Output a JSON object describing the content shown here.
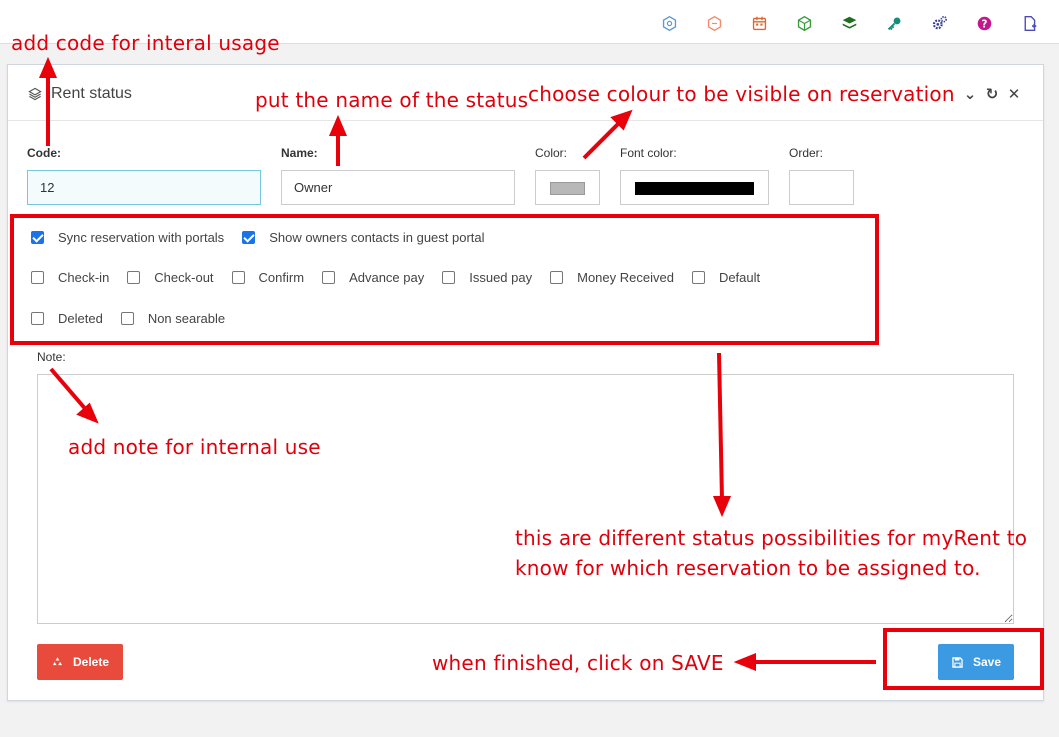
{
  "toolbar": {
    "icons": [
      {
        "name": "portal-icon",
        "color": "#5b9bd5"
      },
      {
        "name": "hexagon-icon",
        "color": "#f28b6b"
      },
      {
        "name": "calendar-icon",
        "color": "#e2662a"
      },
      {
        "name": "cube-icon",
        "color": "#3a9a3a"
      },
      {
        "name": "layers-icon",
        "color": "#1f6e1f"
      },
      {
        "name": "key-icon",
        "color": "#148d7b"
      },
      {
        "name": "cogs-icon",
        "color": "#3a3f8f"
      },
      {
        "name": "help-icon",
        "color": "#c2188b"
      },
      {
        "name": "new-document-icon",
        "color": "#4a4ab8"
      }
    ]
  },
  "panel": {
    "title": "Rent status",
    "tools": {
      "collapse": "⌄",
      "refresh": "↻",
      "close": "✕"
    }
  },
  "form": {
    "code_label": "Code:",
    "code_value": "12",
    "name_label": "Name:",
    "name_value": "Owner",
    "color_label": "Color:",
    "color_value": "#b8b8b8",
    "font_color_label": "Font color:",
    "font_color_value": "#000000",
    "order_label": "Order:",
    "order_value": "",
    "note_label": "Note:",
    "note_value": ""
  },
  "options": {
    "row1": [
      {
        "label": "Sync reservation with portals",
        "checked": true
      },
      {
        "label": "Show owners contacts in guest portal",
        "checked": true
      }
    ],
    "row2": [
      {
        "label": "Check-in",
        "checked": false
      },
      {
        "label": "Check-out",
        "checked": false
      },
      {
        "label": "Confirm",
        "checked": false
      },
      {
        "label": "Advance pay",
        "checked": false
      },
      {
        "label": "Issued pay",
        "checked": false
      },
      {
        "label": "Money Received",
        "checked": false
      },
      {
        "label": "Default",
        "checked": false
      }
    ],
    "row3": [
      {
        "label": "Deleted",
        "checked": false
      },
      {
        "label": "Non searable",
        "checked": false
      }
    ]
  },
  "buttons": {
    "delete_label": "Delete",
    "save_label": "Save"
  },
  "annotations": {
    "code": "add code for interal usage",
    "name": "put the name of the status",
    "color": "choose colour to be visible on reservation",
    "note": "add note for internal use",
    "status_line1": "this are different status possibilities for myRent to",
    "status_line2": "know for which reservation to be assigned to.",
    "save": "when finished, click on SAVE",
    "annotation_color": "#e0000b"
  }
}
